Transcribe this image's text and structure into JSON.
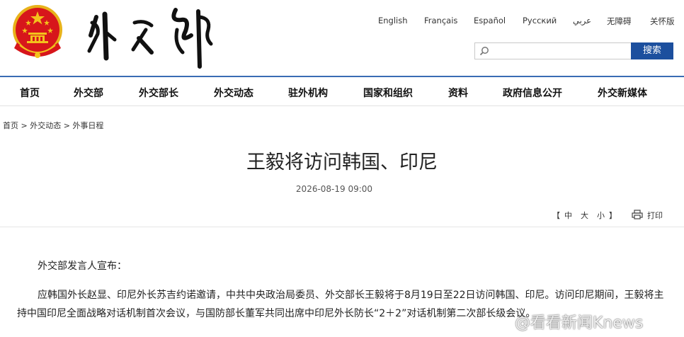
{
  "header": {
    "emblem_icon": "national-emblem-icon",
    "logo_calligraphy": "外交部",
    "languages": [
      "English",
      "Français",
      "Español",
      "Русский",
      "عربي",
      "无障碍",
      "关怀版"
    ],
    "search": {
      "placeholder": "",
      "button_label": "搜索",
      "icon": "search-icon"
    }
  },
  "nav": {
    "items": [
      "首页",
      "外交部",
      "外交部长",
      "外交动态",
      "驻外机构",
      "国家和组织",
      "资料",
      "政府信息公开",
      "外交新媒体"
    ]
  },
  "breadcrumb": [
    "首页",
    ">",
    "外交动态",
    ">",
    "外事日程"
  ],
  "article": {
    "title": "王毅将访问韩国、印尼",
    "date": "2026-08-19 09:00",
    "font_tools": {
      "left_bracket": "【",
      "sizes": [
        "中",
        "大",
        "小"
      ],
      "right_bracket": "】"
    },
    "print_label": "打印",
    "print_icon": "printer-icon",
    "paragraphs": [
      "外交部发言人宣布：",
      "应韩国外长赵显、印尼外长苏吉约诺邀请，中共中央政治局委员、外交部长王毅将于8月19日至22日访问韩国、印尼。访问印尼期间，王毅将主持中国印尼全面战略对话机制首次会议，与国防部长董军共同出席中印尼外长防长“2＋2”对话机制第二次部长级会议。"
    ]
  },
  "watermark": "@看看新闻Knews",
  "colors": {
    "accent": "#1c4f9e",
    "nav_line": "#3a6cb4",
    "emblem_red": "#d7161b",
    "emblem_gold": "#f3c21c"
  }
}
